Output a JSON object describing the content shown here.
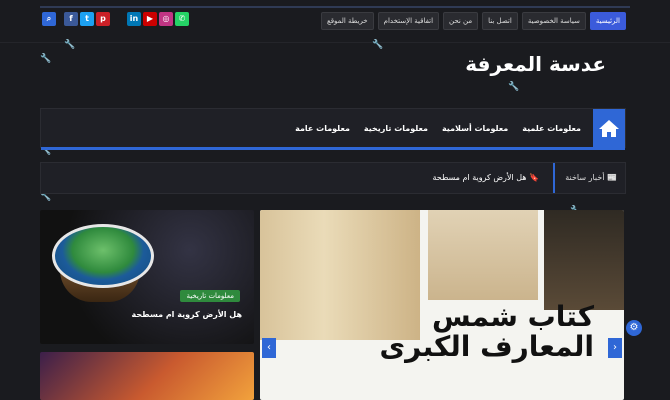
{
  "colors": {
    "accent": "#2f67d6",
    "background": "#1a1b1f"
  },
  "topbar": {
    "social": [
      {
        "name": "search-icon",
        "glyph": "⌕",
        "color": "#2f67d6"
      },
      {
        "name": "facebook-icon",
        "glyph": "f",
        "color": "#3b5998"
      },
      {
        "name": "twitter-icon",
        "glyph": "t",
        "color": "#1da1f2"
      },
      {
        "name": "pinterest-icon",
        "glyph": "p",
        "color": "#cb2027"
      },
      {
        "name": "linkedin-icon",
        "glyph": "in",
        "color": "#0077b5"
      },
      {
        "name": "youtube-icon",
        "glyph": "▶",
        "color": "#cc0000"
      },
      {
        "name": "instagram-icon",
        "glyph": "◎",
        "color": "#c13584"
      },
      {
        "name": "whatsapp-icon",
        "glyph": "✆",
        "color": "#25d366"
      }
    ],
    "links": [
      "الرئيسية",
      "سياسة الخصوصية",
      "اتصل بنا",
      "من نحن",
      "اتفاقية الإستخدام",
      "خريطة الموقع"
    ]
  },
  "site": {
    "title": "عدسة المعرفة"
  },
  "nav": {
    "items": [
      "معلومات علمية",
      "معلومات أسلامية",
      "معلومات تاريخية",
      "معلومات عامة"
    ]
  },
  "ticker": {
    "label": "أخبار ساخنة",
    "headline": "هل الأرض كروية ام مسطحة"
  },
  "posts": [
    {
      "badge": "معلومات تاريخية",
      "title": "هل الأرض كروية ام مسطحة"
    }
  ],
  "slider": {
    "book_title_line1": "كتاب شمس",
    "book_title_line2": "المعارف الكبرى",
    "prev": "‹",
    "next": "›"
  }
}
